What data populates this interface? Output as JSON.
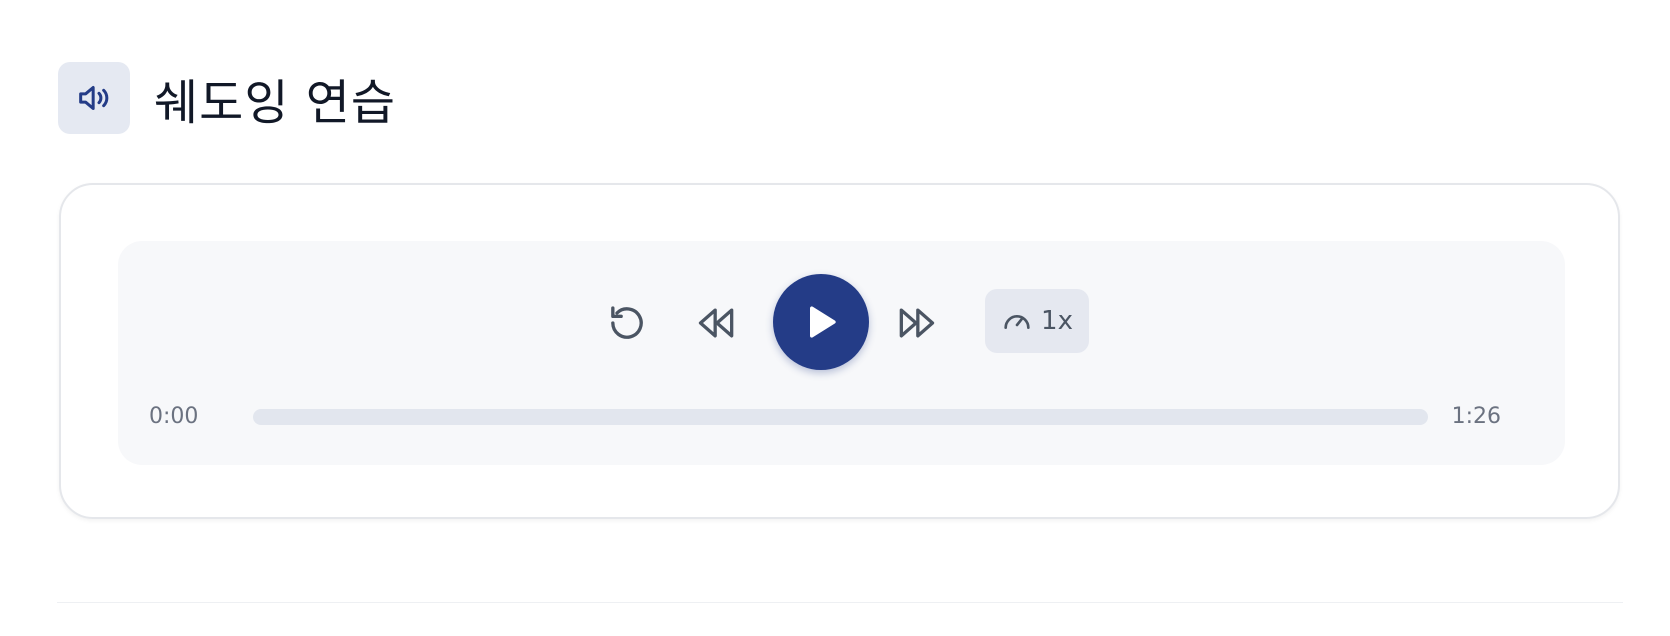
{
  "header": {
    "title": "쉐도잉 연습",
    "icon": "speaker-icon"
  },
  "player": {
    "controls": {
      "restart_icon": "restart-icon",
      "rewind_icon": "rewind-icon",
      "play_icon": "play-icon",
      "forward_icon": "fast-forward-icon",
      "speed_icon": "speedometer-icon"
    },
    "speed_label": "1x",
    "current_time": "0:00",
    "total_time": "1:26",
    "progress": 0
  },
  "colors": {
    "accent": "#243c87",
    "icon_bg": "#e5e9f2",
    "panel_bg": "#f7f8fa",
    "track": "#e2e6ee"
  }
}
